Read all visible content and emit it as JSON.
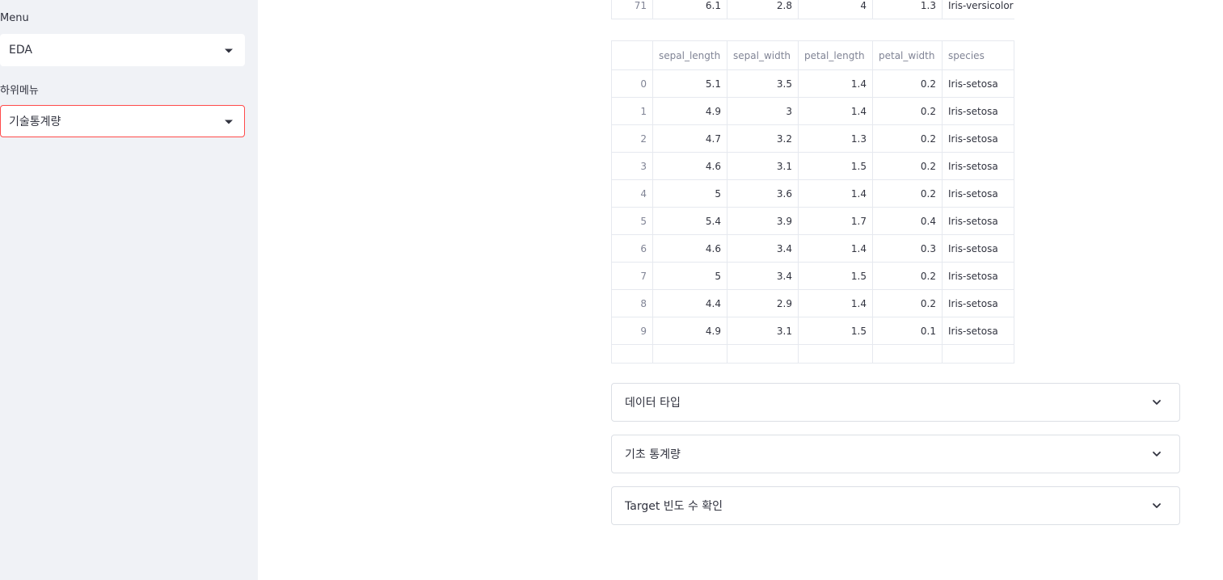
{
  "sidebar": {
    "menu_label": "Menu",
    "menu_value": "EDA",
    "submenu_label": "하위메뉴",
    "submenu_value": "기술통계량"
  },
  "prev_table_row": {
    "index": "71",
    "cells": [
      "6.1",
      "2.8",
      "4",
      "1.3",
      "Iris-versicolor"
    ]
  },
  "dataframe": {
    "columns": [
      "sepal_length",
      "sepal_width",
      "petal_length",
      "petal_width",
      "species"
    ],
    "rows": [
      {
        "index": "0",
        "cells": [
          "5.1",
          "3.5",
          "1.4",
          "0.2",
          "Iris-setosa"
        ]
      },
      {
        "index": "1",
        "cells": [
          "4.9",
          "3",
          "1.4",
          "0.2",
          "Iris-setosa"
        ]
      },
      {
        "index": "2",
        "cells": [
          "4.7",
          "3.2",
          "1.3",
          "0.2",
          "Iris-setosa"
        ]
      },
      {
        "index": "3",
        "cells": [
          "4.6",
          "3.1",
          "1.5",
          "0.2",
          "Iris-setosa"
        ]
      },
      {
        "index": "4",
        "cells": [
          "5",
          "3.6",
          "1.4",
          "0.2",
          "Iris-setosa"
        ]
      },
      {
        "index": "5",
        "cells": [
          "5.4",
          "3.9",
          "1.7",
          "0.4",
          "Iris-setosa"
        ]
      },
      {
        "index": "6",
        "cells": [
          "4.6",
          "3.4",
          "1.4",
          "0.3",
          "Iris-setosa"
        ]
      },
      {
        "index": "7",
        "cells": [
          "5",
          "3.4",
          "1.5",
          "0.2",
          "Iris-setosa"
        ]
      },
      {
        "index": "8",
        "cells": [
          "4.4",
          "2.9",
          "1.4",
          "0.2",
          "Iris-setosa"
        ]
      },
      {
        "index": "9",
        "cells": [
          "4.9",
          "3.1",
          "1.5",
          "0.1",
          "Iris-setosa"
        ]
      }
    ]
  },
  "expanders": [
    {
      "label": "데이터 타입"
    },
    {
      "label": "기초 통계량"
    },
    {
      "label": "Target 빈도 수 확인"
    }
  ],
  "colors": {
    "sidebar_bg": "#f0f2f6",
    "focus_border": "#ff4b4b",
    "grid": "#e6e9ef",
    "text": "#31333f",
    "muted": "#808495"
  }
}
